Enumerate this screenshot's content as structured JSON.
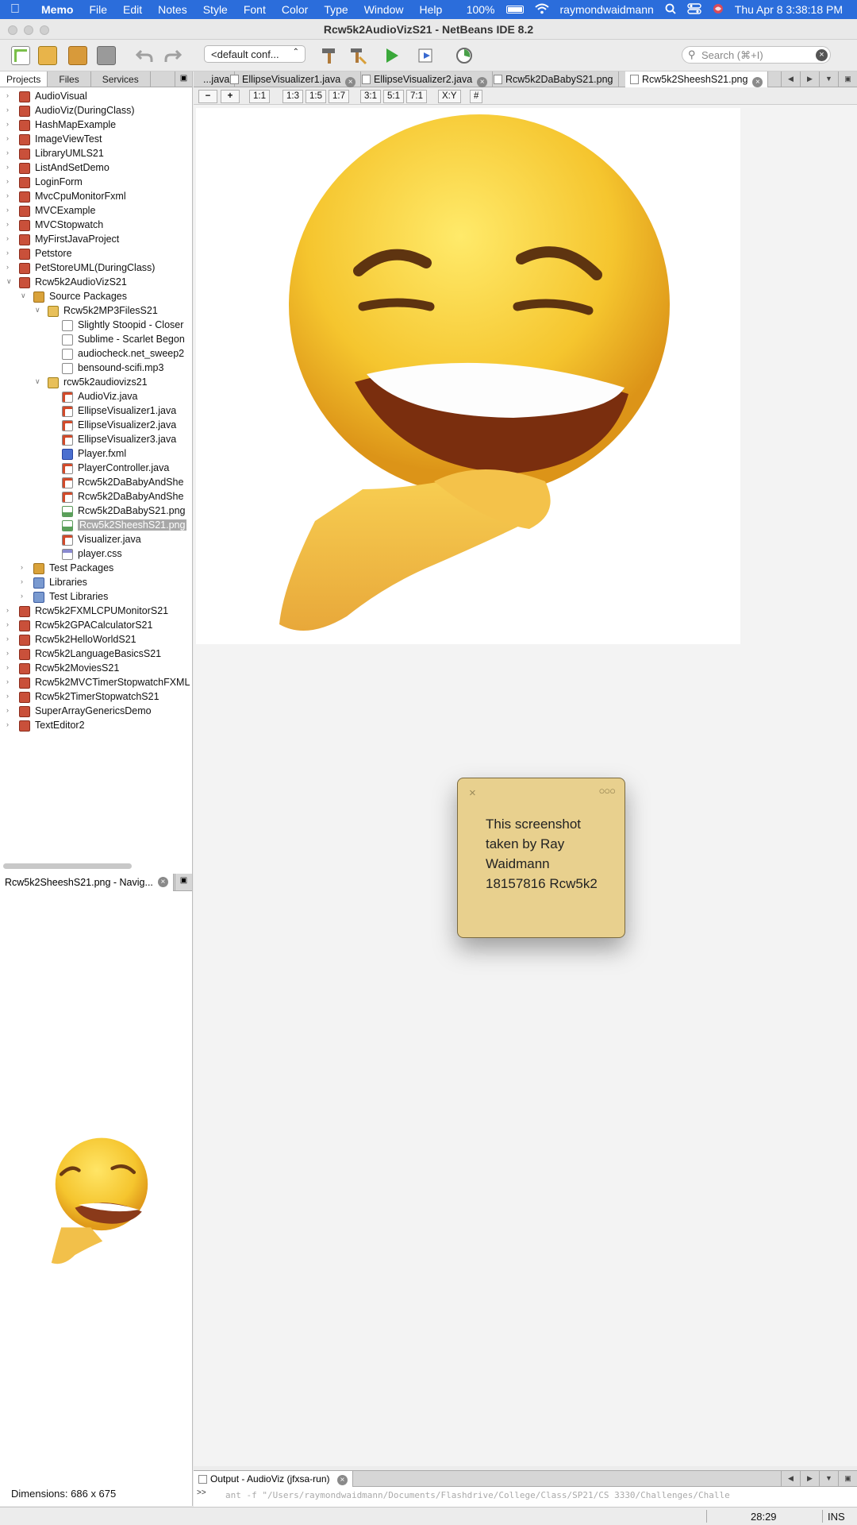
{
  "menubar": {
    "app": "Memo",
    "items": [
      "File",
      "Edit",
      "Notes",
      "Style",
      "Font",
      "Color",
      "Type",
      "Window",
      "Help"
    ],
    "battery": "100%",
    "user": "raymondwaidmann",
    "datetime": "Thu Apr 8  3:38:18 PM"
  },
  "window": {
    "title": "Rcw5k2AudioVizS21 - NetBeans IDE 8.2"
  },
  "toolbar": {
    "config": "<default conf...",
    "search_placeholder": "Search (⌘+I)"
  },
  "projects_pane": {
    "tabs": [
      "Projects",
      "Files",
      "Services"
    ],
    "tree": [
      {
        "label": "AudioVisual",
        "type": "proj",
        "level": 0
      },
      {
        "label": "AudioViz(DuringClass)",
        "type": "proj",
        "level": 0
      },
      {
        "label": "HashMapExample",
        "type": "proj",
        "level": 0
      },
      {
        "label": "ImageViewTest",
        "type": "proj",
        "level": 0
      },
      {
        "label": "LibraryUMLS21",
        "type": "proj",
        "level": 0
      },
      {
        "label": "ListAndSetDemo",
        "type": "proj",
        "level": 0
      },
      {
        "label": "LoginForm",
        "type": "proj",
        "level": 0
      },
      {
        "label": "MvcCpuMonitorFxml",
        "type": "proj",
        "level": 0
      },
      {
        "label": "MVCExample",
        "type": "proj",
        "level": 0
      },
      {
        "label": "MVCStopwatch",
        "type": "proj",
        "level": 0
      },
      {
        "label": "MyFirstJavaProject",
        "type": "proj",
        "level": 0
      },
      {
        "label": "Petstore",
        "type": "proj",
        "level": 0
      },
      {
        "label": "PetStoreUML(DuringClass)",
        "type": "proj",
        "level": 0
      },
      {
        "label": "Rcw5k2AudioVizS21",
        "type": "proj",
        "level": 0,
        "expanded": true
      },
      {
        "label": "Source Packages",
        "type": "pkgroot",
        "level": 1,
        "expanded": true
      },
      {
        "label": "Rcw5k2MP3FilesS21",
        "type": "pkg",
        "level": 2,
        "expanded": true
      },
      {
        "label": "Slightly Stoopid - Closer",
        "type": "file",
        "level": 3
      },
      {
        "label": "Sublime - Scarlet Begon",
        "type": "file",
        "level": 3
      },
      {
        "label": "audiocheck.net_sweep2",
        "type": "file",
        "level": 3
      },
      {
        "label": "bensound-scifi.mp3",
        "type": "file",
        "level": 3
      },
      {
        "label": "rcw5k2audiovizs21",
        "type": "pkg",
        "level": 2,
        "expanded": true
      },
      {
        "label": "AudioViz.java",
        "type": "java",
        "level": 3
      },
      {
        "label": "EllipseVisualizer1.java",
        "type": "java",
        "level": 3
      },
      {
        "label": "EllipseVisualizer2.java",
        "type": "java",
        "level": 3
      },
      {
        "label": "EllipseVisualizer3.java",
        "type": "java",
        "level": 3
      },
      {
        "label": "Player.fxml",
        "type": "fxml",
        "level": 3
      },
      {
        "label": "PlayerController.java",
        "type": "java",
        "level": 3
      },
      {
        "label": "Rcw5k2DaBabyAndShe",
        "type": "java",
        "level": 3
      },
      {
        "label": "Rcw5k2DaBabyAndShe",
        "type": "java",
        "level": 3
      },
      {
        "label": "Rcw5k2DaBabyS21.png",
        "type": "png",
        "level": 3
      },
      {
        "label": "Rcw5k2SheeshS21.png",
        "type": "png",
        "level": 3,
        "selected": true
      },
      {
        "label": "Visualizer.java",
        "type": "java",
        "level": 3
      },
      {
        "label": "player.css",
        "type": "css",
        "level": 3
      },
      {
        "label": "Test Packages",
        "type": "pkgroot",
        "level": 1
      },
      {
        "label": "Libraries",
        "type": "lib",
        "level": 1
      },
      {
        "label": "Test Libraries",
        "type": "lib",
        "level": 1
      },
      {
        "label": "Rcw5k2FXMLCPUMonitorS21",
        "type": "proj",
        "level": 0
      },
      {
        "label": "Rcw5k2GPACalculatorS21",
        "type": "proj",
        "level": 0
      },
      {
        "label": "Rcw5k2HelloWorldS21",
        "type": "proj",
        "level": 0
      },
      {
        "label": "Rcw5k2LanguageBasicsS21",
        "type": "proj",
        "level": 0
      },
      {
        "label": "Rcw5k2MoviesS21",
        "type": "proj",
        "level": 0
      },
      {
        "label": "Rcw5k2MVCTimerStopwatchFXML",
        "type": "proj",
        "level": 0
      },
      {
        "label": "Rcw5k2TimerStopwatchS21",
        "type": "proj",
        "level": 0
      },
      {
        "label": "SuperArrayGenericsDemo",
        "type": "proj",
        "level": 0
      },
      {
        "label": "TextEditor2",
        "type": "proj",
        "level": 0
      }
    ]
  },
  "navigator": {
    "tab": "Rcw5k2SheeshS21.png - Navig...",
    "dimensions": "Dimensions: 686 x 675"
  },
  "editor": {
    "tabs": [
      {
        "label": "...java"
      },
      {
        "label": "EllipseVisualizer1.java"
      },
      {
        "label": "EllipseVisualizer2.java"
      },
      {
        "label": "Rcw5k2DaBabyS21.png"
      },
      {
        "label": "Rcw5k2SheeshS21.png",
        "active": true
      }
    ],
    "image_toolbar": [
      "−",
      "+",
      "1:1",
      "1:3",
      "1:5",
      "1:7",
      "3:1",
      "5:1",
      "7:1",
      "X:Y",
      "#"
    ]
  },
  "note": {
    "text": "This screenshot taken by Ray Waidmann 18157816 Rcw5k2"
  },
  "output": {
    "tab": "Output - AudioViz (jfxsa-run)",
    "gutter": ">>",
    "line": "ant -f \"/Users/raymondwaidmann/Documents/Flashdrive/College/Class/SP21/CS 3330/Challenges/Challe"
  },
  "statusbar": {
    "position": "28:29",
    "mode": "INS"
  },
  "colors": {
    "menubar": "#2b6ddb",
    "note": "#e8d08e",
    "emoji_face": "#f5c52e"
  }
}
